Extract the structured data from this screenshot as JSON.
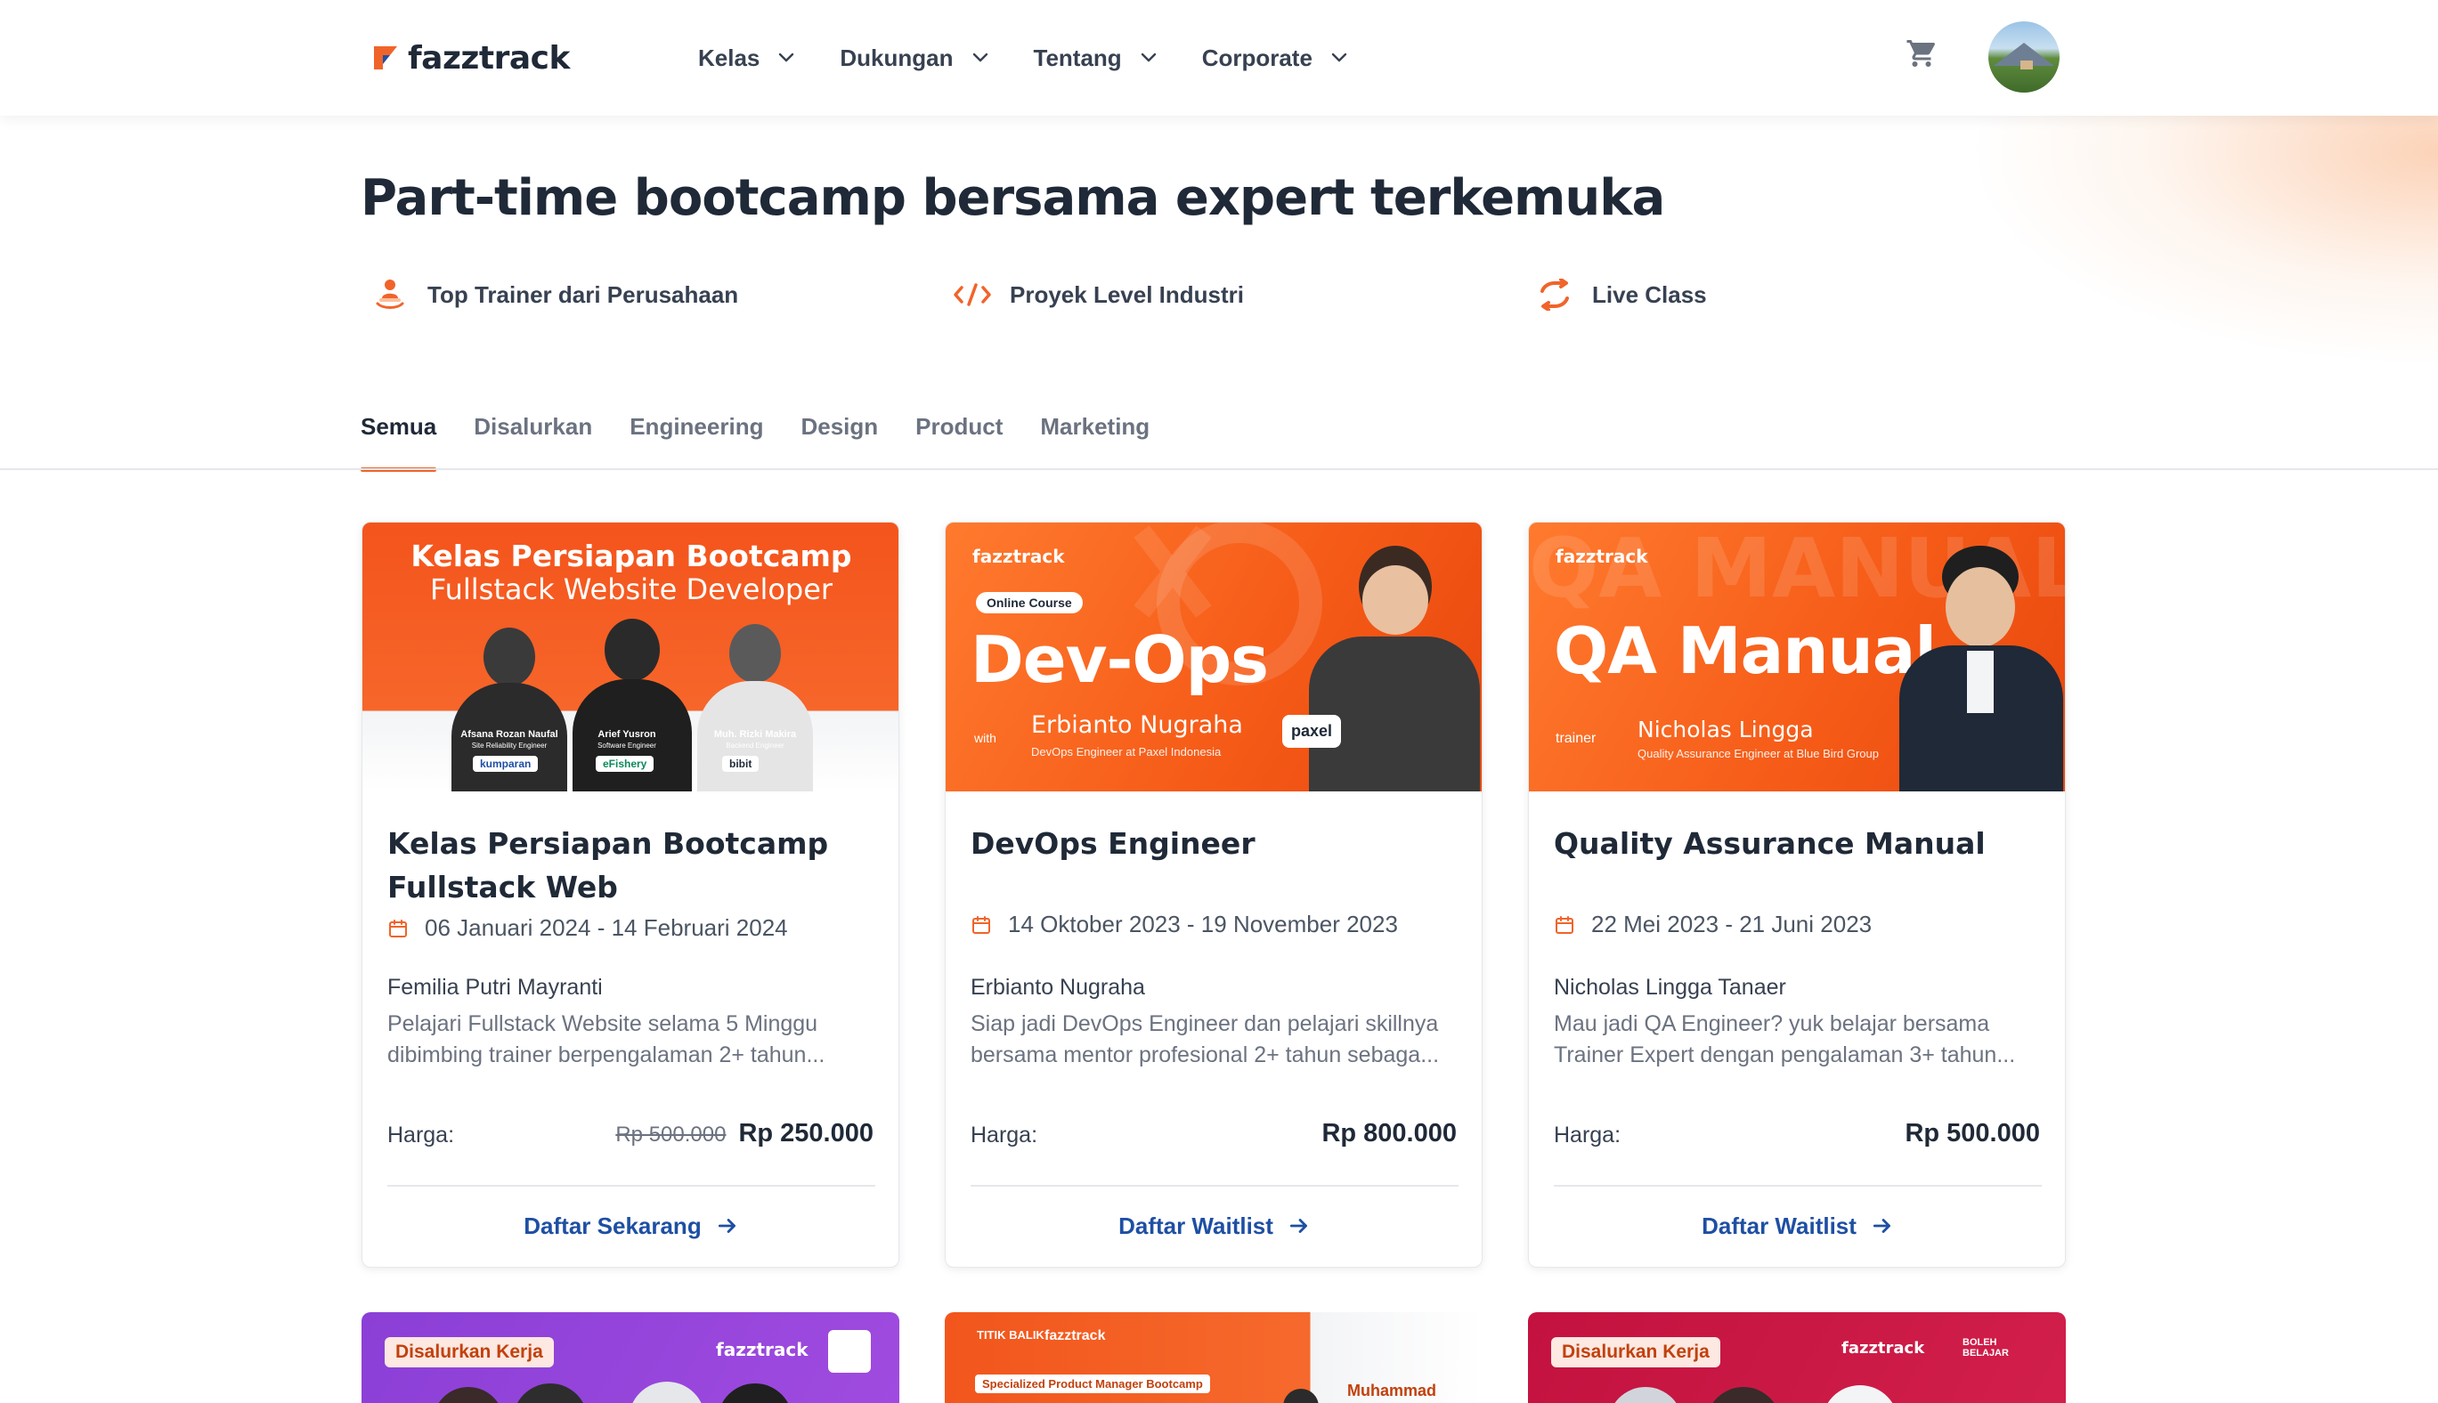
{
  "header": {
    "logo_text": "fazztrack",
    "nav": [
      {
        "label": "Kelas"
      },
      {
        "label": "Dukungan"
      },
      {
        "label": "Tentang"
      },
      {
        "label": "Corporate"
      }
    ],
    "cart_icon": "cart-icon",
    "avatar_icon": "user-avatar"
  },
  "hero": {
    "title": "Part-time bootcamp bersama expert terkemuka",
    "features": [
      {
        "label": "Top Trainer dari Perusahaan",
        "icon": "trainer-icon"
      },
      {
        "label": "Proyek Level Industri",
        "icon": "code-icon"
      },
      {
        "label": "Live Class",
        "icon": "sync-icon"
      }
    ]
  },
  "tabs": [
    "Semua",
    "Disalurkan",
    "Engineering",
    "Design",
    "Product",
    "Marketing"
  ],
  "active_tab": "Semua",
  "colors": {
    "accent": "#f0642a",
    "link": "#1e4fa3",
    "text": "#1f2937"
  },
  "cards": [
    {
      "banner": {
        "line1": "Kelas Persiapan Bootcamp",
        "line2": "Fullstack Website Developer",
        "people": [
          {
            "name": "Afsana Rozan Naufal",
            "role": "Site Reliability Engineer",
            "company": "kumparan"
          },
          {
            "name": "Arief Yusron",
            "role": "Software Engineer",
            "company": "eFishery"
          },
          {
            "name": "Muh. Rizki Makira",
            "role": "Backend Engineer",
            "company": "bibit"
          }
        ]
      },
      "title": "Kelas Persiapan Bootcamp Fullstack Web",
      "date": "06 Januari 2024 - 14 Februari 2024",
      "trainer": "Femilia Putri Mayranti",
      "description": "Pelajari Fullstack Website selama 5 Minggu dibimbing trainer berpengalaman 2+ tahun...",
      "price_label": "Harga:",
      "old_price": "Rp 500.000",
      "price": "Rp 250.000",
      "cta": "Daftar Sekarang"
    },
    {
      "banner": {
        "logo": "fazztrack",
        "pill": "Online Course",
        "headline": "Dev-Ops",
        "with": "with",
        "trainer_name": "Erbianto Nugraha",
        "trainer_role": "DevOps Engineer at Paxel Indonesia",
        "company": "paxel"
      },
      "title": "DevOps Engineer",
      "date": "14 Oktober 2023 - 19 November 2023",
      "trainer": "Erbianto Nugraha",
      "description": "Siap jadi DevOps Engineer dan pelajari skillnya bersama mentor profesional 2+ tahun sebaga...",
      "price_label": "Harga:",
      "price": "Rp 800.000",
      "cta": "Daftar Waitlist"
    },
    {
      "banner": {
        "logo": "fazztrack",
        "watermark": "QA MANUAL",
        "headline": "QA Manual",
        "trainer_tag": "trainer",
        "trainer_name": "Nicholas Lingga",
        "trainer_role": "Quality Assurance Engineer at Blue Bird Group"
      },
      "title": "Quality Assurance Manual",
      "date": "22 Mei 2023 - 21 Juni 2023",
      "trainer": "Nicholas Lingga Tanaer",
      "description": "Mau jadi QA Engineer? yuk belajar bersama Trainer Expert dengan pengalaman 3+ tahun...",
      "price_label": "Harga:",
      "price": "Rp 500.000",
      "cta": "Daftar Waitlist"
    }
  ],
  "more_cards": [
    {
      "badge": "Disalurkan Kerja",
      "logo": "fazztrack"
    },
    {
      "brand": "TITIK BALIK",
      "logo": "fazztrack",
      "tag": "Specialized Product Manager Bootcamp",
      "trainer_name": "Muhammad"
    },
    {
      "badge": "Disalurkan Kerja",
      "logo": "fazztrack",
      "partner": "BOLEH BELAJAR"
    }
  ]
}
